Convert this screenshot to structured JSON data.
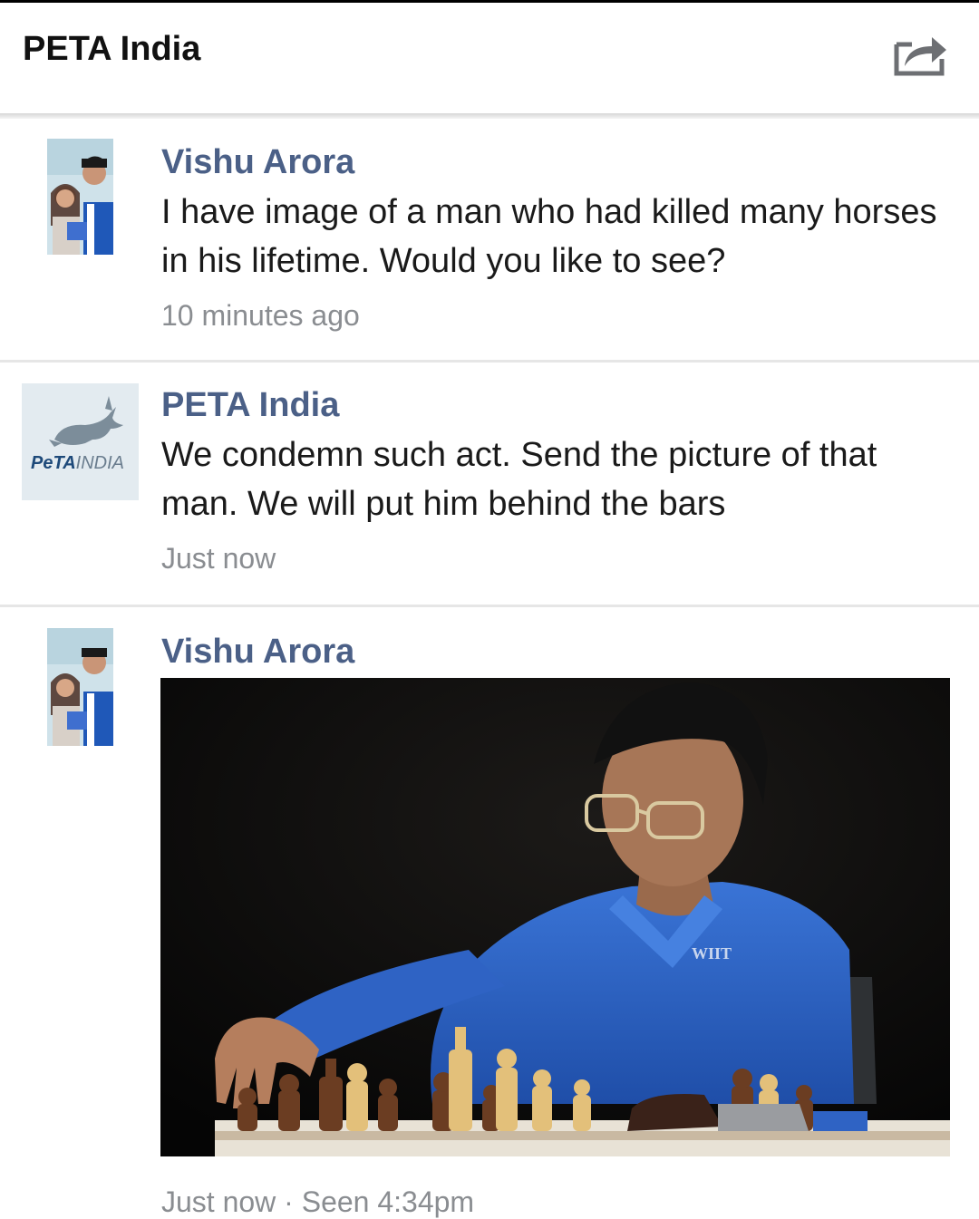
{
  "header": {
    "title": "PETA India",
    "share_icon": "share-icon"
  },
  "messages": [
    {
      "sender": "Vishu Arora",
      "text": "I have image of a man who had killed many horses in his lifetime. Would you like to see?",
      "time": "10 minutes ago"
    },
    {
      "sender": "PETA India",
      "text": "We condemn such act. Send the picture of that man. We will put him behind the bars",
      "time": "Just now",
      "avatar_logo": {
        "peta": "PeTA",
        "india": "INDIA"
      }
    },
    {
      "sender": "Vishu Arora",
      "time": "Just now · Seen 4:34pm",
      "photo": {
        "shirt_text": "WIIT"
      }
    }
  ],
  "colors": {
    "sender_name": "#4b6087",
    "timestamp": "#8a8d91",
    "separator": "#e6e6e6",
    "shirt_blue": "#2f63c4"
  }
}
